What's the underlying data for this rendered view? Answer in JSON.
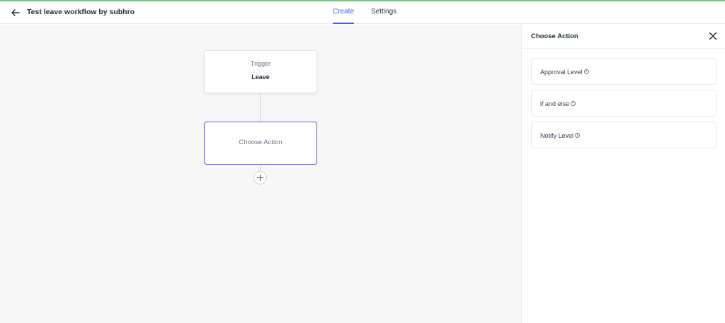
{
  "header": {
    "title": "Test leave workflow by subhro",
    "tabs": [
      {
        "label": "Create",
        "active": true
      },
      {
        "label": "Settings",
        "active": false
      }
    ]
  },
  "canvas": {
    "trigger": {
      "label": "Trigger",
      "value": "Leave"
    },
    "action": {
      "label": "Choose Action"
    }
  },
  "panel": {
    "title": "Choose Action",
    "options": [
      {
        "label": "Approval Level"
      },
      {
        "label": "if and else"
      },
      {
        "label": "Notify Level"
      }
    ],
    "info_glyph": "i"
  },
  "colors": {
    "accent": "#4a5be0",
    "top_bar": "#7bc47f",
    "canvas_bg": "#f7f7f7"
  }
}
